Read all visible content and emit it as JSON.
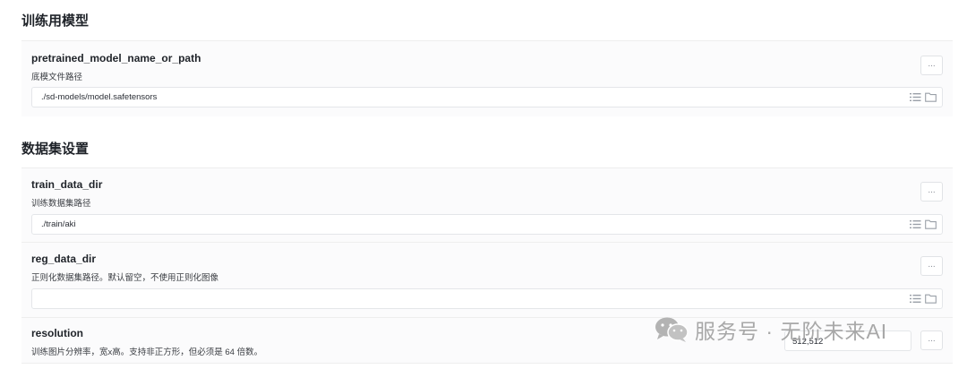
{
  "sections": [
    {
      "title": "训练用模型"
    },
    {
      "title": "数据集设置"
    }
  ],
  "fields": [
    {
      "name": "pretrained_model_name_or_path",
      "desc": "底模文件路径",
      "value": "./sd-models/model.safetensors",
      "more": "..."
    },
    {
      "name": "train_data_dir",
      "desc": "训练数据集路径",
      "value": "./train/aki",
      "more": "..."
    },
    {
      "name": "reg_data_dir",
      "desc": "正则化数据集路径。默认留空，不使用正则化图像",
      "value": "",
      "more": "..."
    },
    {
      "name": "resolution",
      "desc": "训练图片分辨率，宽x高。支持非正方形，但必须是 64 倍数。",
      "value": "512,512",
      "more": "..."
    }
  ],
  "icons": {
    "list": "list-icon",
    "folder": "folder-icon",
    "wechat": "wechat-icon"
  },
  "watermark": {
    "text": "服务号 · 无阶未来AI"
  },
  "colors": {
    "icon": "#9aa0a8",
    "border": "#e4e6e9",
    "field_bg": "#fbfbfc"
  }
}
